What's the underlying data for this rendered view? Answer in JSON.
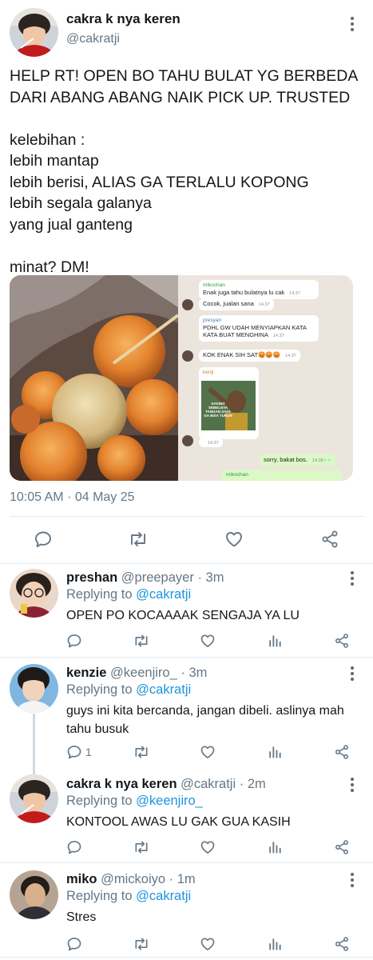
{
  "main_tweet": {
    "display_name": "cakra k nya keren",
    "handle": "@cakratji",
    "text_lines": [
      "HELP RT! OPEN BO TAHU BULAT YG BERBEDA",
      "DARI ABANG ABANG NAIK PICK UP. TRUSTED",
      "",
      "kelebihan :",
      "lebih mantap",
      "lebih berisi, ALIAS GA TERLALU KOPONG",
      "lebih segala galanya",
      "yang jual ganteng",
      "",
      "minat? DM!"
    ],
    "timestamp": "10:05 AM · 04 May 25",
    "chat_screenshot": {
      "messages": [
        {
          "sender": "mikochan",
          "text": "Enak juga tahu bulatnya lu cak",
          "time": "14.37"
        },
        {
          "sender": "",
          "text": "Cocok, jualan sana",
          "time": "14.37"
        },
        {
          "sender": "presyan",
          "text": "PDHL GW UDAH MENYIAPKAN KATA KATA BUAT MENGHINA",
          "time": "14.37"
        },
        {
          "sender": "",
          "text": "KOK ENAK SIH SAT😡😡😡",
          "time": "14.37"
        },
        {
          "sender": "kenji",
          "text": "",
          "time": "14.37"
        },
        {
          "sender": "",
          "text": "sorry, bakat bos.",
          "time": "14.38"
        },
        {
          "sender": "mikochan",
          "text": "",
          "time": ""
        }
      ],
      "sticker_text": "SAKING SEBELNYA TANGAN SAYA GA BISA TURUN"
    }
  },
  "replies": [
    {
      "display_name": "preshan",
      "handle": "@preepayer",
      "age": "· 3m",
      "replying_prefix": "Replying to ",
      "replying_to": "@cakratji",
      "text": "OPEN PO KOCAAAAK SENGAJA YA LU",
      "reply_count": ""
    },
    {
      "display_name": "kenzie",
      "handle": "@keenjiro_",
      "age": "· 3m",
      "replying_prefix": "Replying to ",
      "replying_to": "@cakratji",
      "text": "guys ini kita bercanda, jangan dibeli. aslinya mah tahu busuk",
      "reply_count": "1"
    },
    {
      "display_name": "cakra k nya keren",
      "handle": "@cakratji",
      "age": "· 2m",
      "replying_prefix": "Replying to ",
      "replying_to": "@keenjiro_",
      "text": "KONTOOL AWAS LU GAK GUA KASIH",
      "reply_count": ""
    },
    {
      "display_name": "miko",
      "handle": "@mickoiyo",
      "age": "· 1m",
      "replying_prefix": "Replying to ",
      "replying_to": "@cakratji",
      "text": "Stres",
      "reply_count": ""
    }
  ],
  "colors": {
    "text": "#14171a",
    "secondary": "#657786",
    "link": "#1b95e0",
    "divider": "#e1e8ed"
  }
}
